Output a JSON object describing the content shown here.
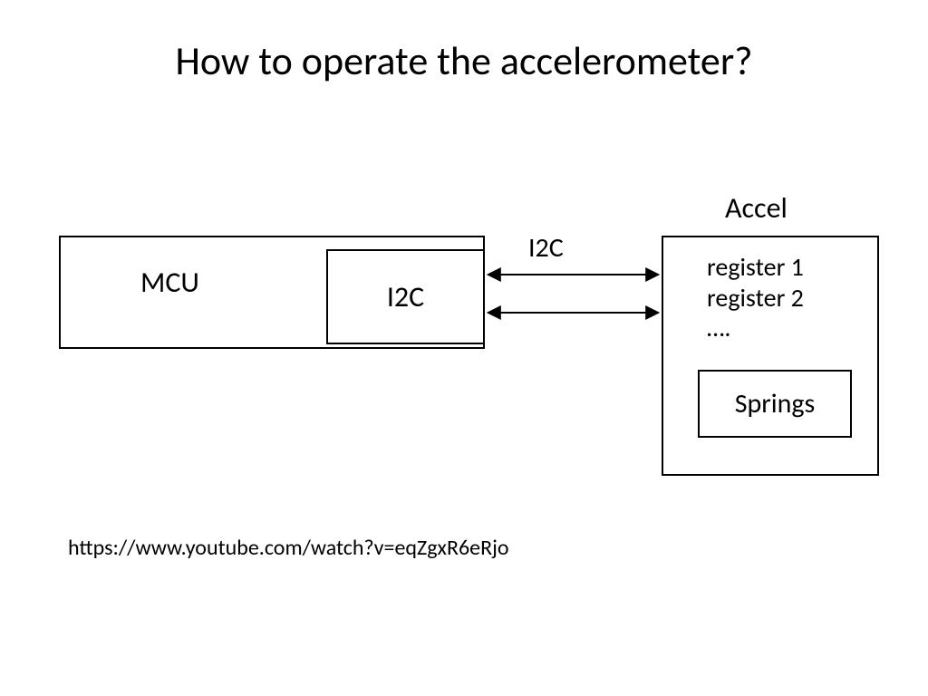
{
  "title": "How to operate the accelerometer?",
  "mcu": {
    "label": "MCU",
    "interface_label": "I2C"
  },
  "bus": {
    "label": "I2C"
  },
  "accel": {
    "title": "Accel",
    "registers": [
      "register 1",
      "register 2",
      "…."
    ],
    "mechanism": "Springs"
  },
  "footer_link": "https://www.youtube.com/watch?v=eqZgxR6eRjo"
}
